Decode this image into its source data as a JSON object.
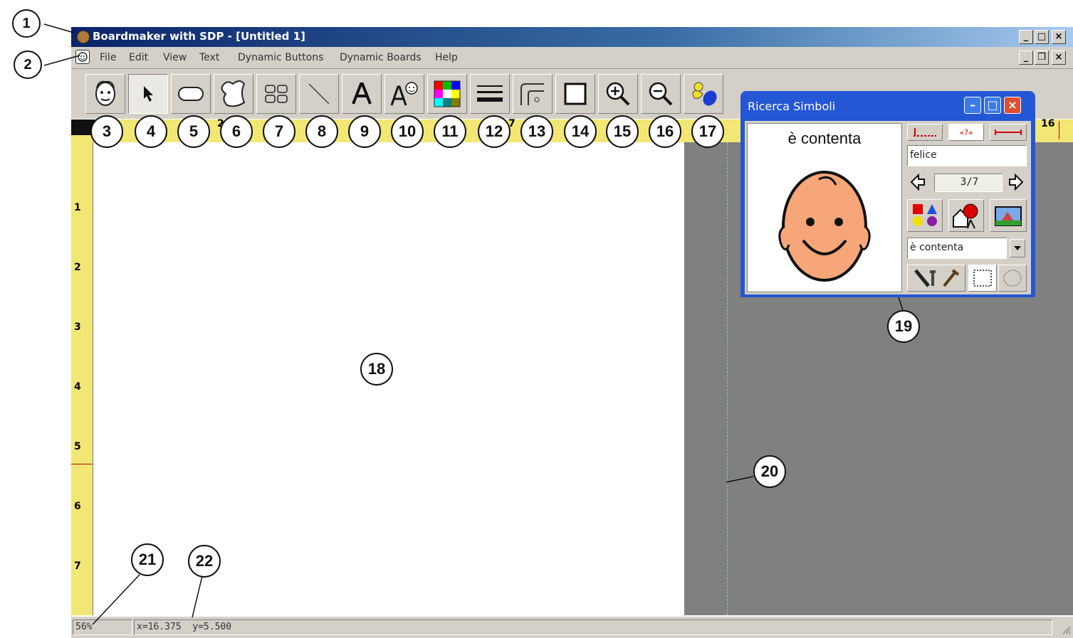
{
  "window": {
    "title": "Boardmaker with SDP - [Untitled 1]",
    "title_buttons": [
      "_",
      "□",
      "×"
    ],
    "menu_buttons": [
      "_",
      "❐",
      "×"
    ]
  },
  "menu": {
    "items": [
      "File",
      "Edit",
      "View",
      "Text",
      "Dynamic Buttons",
      "Dynamic Boards",
      "Help"
    ]
  },
  "toolbar": {
    "tools": [
      {
        "icon": "symbol-finder-icon",
        "callout": "3"
      },
      {
        "icon": "pointer-icon",
        "callout": "4"
      },
      {
        "icon": "button-icon",
        "callout": "5"
      },
      {
        "icon": "freeform-button-icon",
        "callout": "6"
      },
      {
        "icon": "button-sequence-icon",
        "callout": "7"
      },
      {
        "icon": "line-icon",
        "callout": "8"
      },
      {
        "icon": "text-icon",
        "callout": "9"
      },
      {
        "icon": "symbolate-icon",
        "callout": "10"
      },
      {
        "icon": "color-palette-icon",
        "callout": "11"
      },
      {
        "icon": "line-thickness-icon",
        "callout": "12"
      },
      {
        "icon": "corner-style-icon",
        "callout": "13"
      },
      {
        "icon": "border-icon",
        "callout": "14"
      },
      {
        "icon": "zoom-in-icon",
        "callout": "15"
      },
      {
        "icon": "zoom-out-icon",
        "callout": "16"
      },
      {
        "icon": "color-fill-icon",
        "callout": "17"
      }
    ]
  },
  "ruler": {
    "top_marks": [
      "2",
      "7",
      "16"
    ],
    "left_marks": [
      "1",
      "2",
      "3",
      "4",
      "5",
      "6",
      "7"
    ]
  },
  "callouts": {
    "title": "1",
    "menu": "2",
    "canvas": "18",
    "dialog": "19",
    "page_edge": "20",
    "zoom": "21",
    "coords": "22"
  },
  "status": {
    "zoom": "56%",
    "coords": "x=16.375  y=5.500"
  },
  "dialog": {
    "title": "Ricerca Simboli",
    "symbol_name": "è contenta",
    "search_text": "felice",
    "page_counter": "3/7",
    "dropdown_value": "è contenta",
    "text_position_labels": [
      "«?»"
    ]
  }
}
